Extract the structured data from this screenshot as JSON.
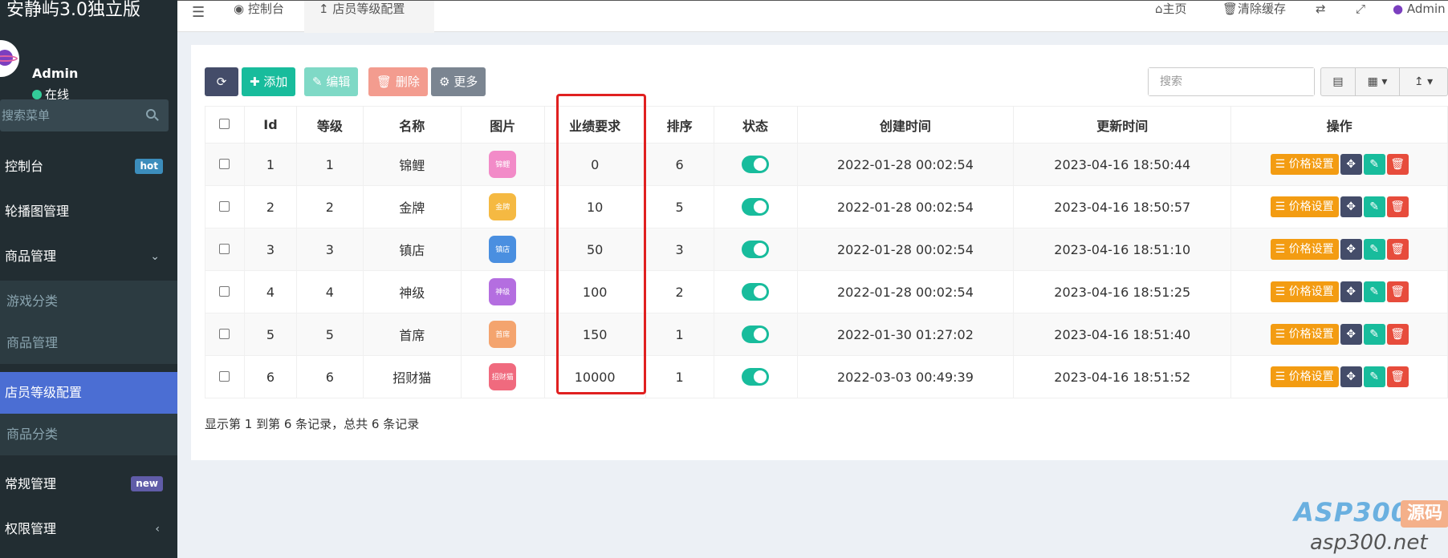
{
  "sidebar": {
    "brand": "安静屿3.0独立版",
    "user_name": "Admin",
    "user_status": "在线",
    "search_placeholder": "搜索菜单",
    "items": [
      {
        "label": "控制台",
        "badge": "hot"
      },
      {
        "label": "轮播图管理"
      },
      {
        "label": "商品管理"
      },
      {
        "label": "游戏分类"
      },
      {
        "label": "商品管理"
      },
      {
        "label": "店员等级配置"
      },
      {
        "label": "商品分类"
      },
      {
        "label": "常规管理",
        "badge": "new"
      },
      {
        "label": "权限管理"
      }
    ]
  },
  "topbar": {
    "tabs": [
      "控制台",
      "店员等级配置"
    ],
    "home": "主页",
    "clear_cache": "清除缓存",
    "user": "Admin"
  },
  "toolbar": {
    "add": "添加",
    "edit": "编辑",
    "delete": "删除",
    "more": "更多",
    "search_placeholder": "搜索"
  },
  "table": {
    "columns": [
      "Id",
      "等级",
      "名称",
      "图片",
      "业绩要求",
      "排序",
      "状态",
      "创建时间",
      "更新时间",
      "操作"
    ],
    "price_button": "价格设置",
    "rows": [
      {
        "id": "1",
        "level": "1",
        "name": "锦鲤",
        "img": "锦鲤",
        "img_color": "#f28bc8",
        "req": "0",
        "sort": "6",
        "created": "2022-01-28 00:02:54",
        "updated": "2023-04-16 18:50:44"
      },
      {
        "id": "2",
        "level": "2",
        "name": "金牌",
        "img": "金牌",
        "img_color": "#f5b942",
        "req": "10",
        "sort": "5",
        "created": "2022-01-28 00:02:54",
        "updated": "2023-04-16 18:50:57"
      },
      {
        "id": "3",
        "level": "3",
        "name": "镇店",
        "img": "镇店",
        "img_color": "#4a8fe0",
        "req": "50",
        "sort": "3",
        "created": "2022-01-28 00:02:54",
        "updated": "2023-04-16 18:51:10"
      },
      {
        "id": "4",
        "level": "4",
        "name": "神级",
        "img": "神级",
        "img_color": "#b46ee0",
        "req": "100",
        "sort": "2",
        "created": "2022-01-28 00:02:54",
        "updated": "2023-04-16 18:51:25"
      },
      {
        "id": "5",
        "level": "5",
        "name": "首席",
        "img": "首席",
        "img_color": "#f4a46e",
        "req": "150",
        "sort": "1",
        "created": "2022-01-30 01:27:02",
        "updated": "2023-04-16 18:51:40"
      },
      {
        "id": "6",
        "level": "6",
        "name": "招财猫",
        "img": "招财猫",
        "img_color": "#f06a7e",
        "req": "10000",
        "sort": "1",
        "created": "2022-03-03 00:49:39",
        "updated": "2023-04-16 18:51:52"
      }
    ]
  },
  "pagination_info": "显示第 1 到第 6 条记录，总共 6 条记录",
  "watermark": {
    "brand": "ASP300",
    "tag": "源码",
    "url": "asp300.net"
  }
}
